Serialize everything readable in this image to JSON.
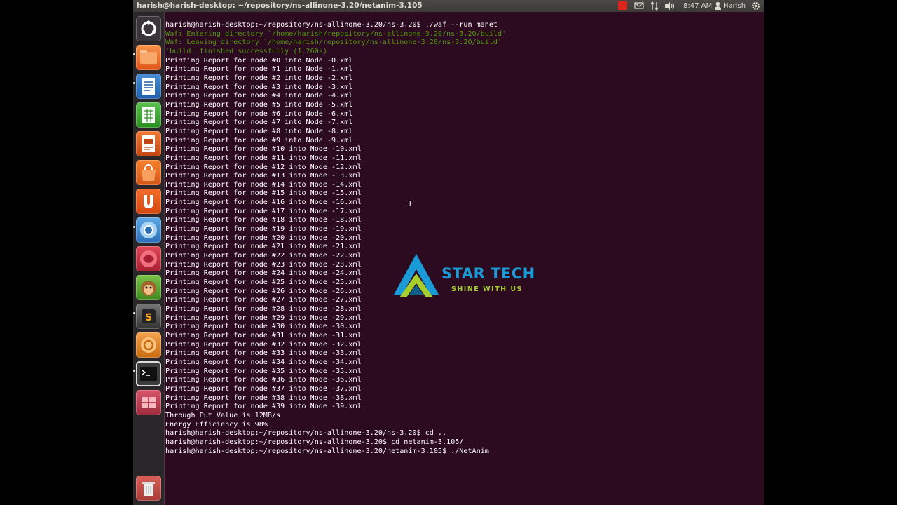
{
  "window": {
    "title": "harish@harish-desktop: ~/repository/ns-allinone-3.20/netanim-3.105"
  },
  "panel": {
    "time": "8:47 AM",
    "user": "Harish",
    "icons": [
      "record-icon",
      "mail-icon",
      "network-icon",
      "volume-icon",
      "user-icon",
      "gear-icon"
    ]
  },
  "launcher": {
    "items": [
      "dash-home-icon",
      "files-icon",
      "writer-icon",
      "calc-icon",
      "impress-icon",
      "software-center-icon",
      "ubuntu-one-icon",
      "chromium-icon",
      "app-icon",
      "monkey-app-icon",
      "sublime-text-icon",
      "ubuntu-tweak-icon",
      "terminal-icon",
      "workspace-switcher-icon",
      "trash-icon"
    ]
  },
  "logo": {
    "brand": "STAR TECH",
    "tagline": "SHINE WITH US"
  },
  "terminal": {
    "lines": [
      "harish@harish-desktop:~/repository/ns-allinone-3.20/ns-3.20$ ./waf --run manet",
      "Waf: Entering directory `/home/harish/repository/ns-allinone-3.20/ns-3.20/build'",
      "Waf: Leaving directory `/home/harish/repository/ns-allinone-3.20/ns-3.20/build'",
      "'build' finished successfully (1.260s)",
      "Printing Report for node #0 into Node -0.xml",
      "Printing Report for node #1 into Node -1.xml",
      "Printing Report for node #2 into Node -2.xml",
      "Printing Report for node #3 into Node -3.xml",
      "Printing Report for node #4 into Node -4.xml",
      "Printing Report for node #5 into Node -5.xml",
      "Printing Report for node #6 into Node -6.xml",
      "Printing Report for node #7 into Node -7.xml",
      "Printing Report for node #8 into Node -8.xml",
      "Printing Report for node #9 into Node -9.xml",
      "Printing Report for node #10 into Node -10.xml",
      "Printing Report for node #11 into Node -11.xml",
      "Printing Report for node #12 into Node -12.xml",
      "Printing Report for node #13 into Node -13.xml",
      "Printing Report for node #14 into Node -14.xml",
      "Printing Report for node #15 into Node -15.xml",
      "Printing Report for node #16 into Node -16.xml",
      "Printing Report for node #17 into Node -17.xml",
      "Printing Report for node #18 into Node -18.xml",
      "Printing Report for node #19 into Node -19.xml",
      "Printing Report for node #20 into Node -20.xml",
      "Printing Report for node #21 into Node -21.xml",
      "Printing Report for node #22 into Node -22.xml",
      "Printing Report for node #23 into Node -23.xml",
      "Printing Report for node #24 into Node -24.xml",
      "Printing Report for node #25 into Node -25.xml",
      "Printing Report for node #26 into Node -26.xml",
      "Printing Report for node #27 into Node -27.xml",
      "Printing Report for node #28 into Node -28.xml",
      "Printing Report for node #29 into Node -29.xml",
      "Printing Report for node #30 into Node -30.xml",
      "Printing Report for node #31 into Node -31.xml",
      "Printing Report for node #32 into Node -32.xml",
      "Printing Report for node #33 into Node -33.xml",
      "Printing Report for node #34 into Node -34.xml",
      "Printing Report for node #35 into Node -35.xml",
      "Printing Report for node #36 into Node -36.xml",
      "Printing Report for node #37 into Node -37.xml",
      "Printing Report for node #38 into Node -38.xml",
      "Printing Report for node #39 into Node -39.xml",
      "Through Put Value is 12MB/s",
      "Energy Efficiency is 98%",
      "harish@harish-desktop:~/repository/ns-allinone-3.20/ns-3.20$ cd ..",
      "harish@harish-desktop:~/repository/ns-allinone-3.20$ cd netanim-3.105/",
      "harish@harish-desktop:~/repository/ns-allinone-3.20/netanim-3.105$ ./NetAnim"
    ]
  },
  "colors": {
    "terminal_bg": "#2c0a20",
    "terminal_fg": "#ffffff",
    "waf_green": "#4e9a06",
    "logo_blue": "#1a9bd7",
    "logo_green": "#a6cf2e"
  }
}
